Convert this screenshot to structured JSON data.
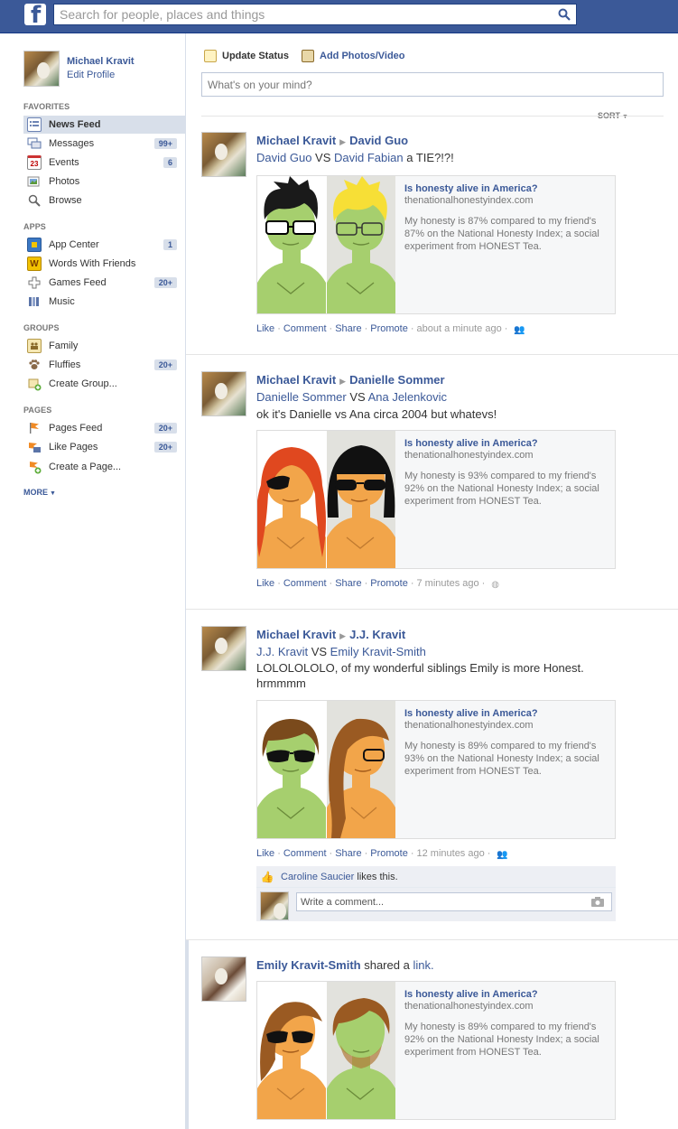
{
  "topbar": {
    "logo": "f",
    "search_placeholder": "Search for people, places and things",
    "search_icon": "magnifier-icon"
  },
  "profile": {
    "name": "Michael Kravit",
    "edit": "Edit Profile"
  },
  "sidebar": {
    "favorites_head": "FAVORITES",
    "favorites": [
      {
        "label": "News Feed",
        "icon": "news-feed-icon",
        "count": ""
      },
      {
        "label": "Messages",
        "icon": "messages-icon",
        "count": "99+"
      },
      {
        "label": "Events",
        "icon": "calendar-icon",
        "count": "6"
      },
      {
        "label": "Photos",
        "icon": "photos-icon",
        "count": ""
      },
      {
        "label": "Browse",
        "icon": "search-icon",
        "count": ""
      }
    ],
    "apps_head": "APPS",
    "apps": [
      {
        "label": "App Center",
        "icon": "app-center-icon",
        "count": "1"
      },
      {
        "label": "Words With Friends",
        "icon": "words-with-friends-icon",
        "count": ""
      },
      {
        "label": "Games Feed",
        "icon": "games-icon",
        "count": "20+"
      },
      {
        "label": "Music",
        "icon": "music-icon",
        "count": ""
      }
    ],
    "groups_head": "GROUPS",
    "groups": [
      {
        "label": "Family",
        "icon": "group-icon",
        "count": ""
      },
      {
        "label": "Fluffies",
        "icon": "paw-icon",
        "count": "20+"
      },
      {
        "label": "Create Group...",
        "icon": "create-group-icon",
        "count": ""
      }
    ],
    "pages_head": "PAGES",
    "pages": [
      {
        "label": "Pages Feed",
        "icon": "flag-icon",
        "count": "20+"
      },
      {
        "label": "Like Pages",
        "icon": "like-pages-icon",
        "count": "20+"
      },
      {
        "label": "Create a Page...",
        "icon": "create-page-icon",
        "count": ""
      }
    ],
    "more": "MORE"
  },
  "composer": {
    "update_status": "Update Status",
    "add_photos": "Add Photos/Video",
    "placeholder": "What's on your mind?",
    "sort": "SORT"
  },
  "share_card": {
    "title": "Is honesty alive in America?",
    "domain": "thenationalhonestyindex.com"
  },
  "stories": [
    {
      "actor": "Michael Kravit",
      "target": "David Guo",
      "vs_a": "David Guo",
      "vs_word": "VS",
      "vs_b": "David Fabian",
      "vs_suffix": "a TIE?!?!",
      "message": "",
      "desc": "My honesty is 87% compared to my friend's 87% on the National Honesty Index; a social experiment from HONEST Tea.",
      "actions": [
        "Like",
        "Comment",
        "Share",
        "Promote"
      ],
      "time": "about a minute ago"
    },
    {
      "actor": "Michael Kravit",
      "target": "Danielle Sommer",
      "vs_a": "Danielle Sommer",
      "vs_word": "VS",
      "vs_b": "Ana Jelenkovic",
      "vs_suffix": "",
      "message": "ok it's Danielle vs Ana circa 2004 but whatevs!",
      "desc": "My honesty is 93% compared to my friend's 92% on the National Honesty Index; a social experiment from HONEST Tea.",
      "actions": [
        "Like",
        "Comment",
        "Share",
        "Promote"
      ],
      "time": "7 minutes ago"
    },
    {
      "actor": "Michael Kravit",
      "target": "J.J. Kravit",
      "vs_a": "J.J. Kravit",
      "vs_word": "VS",
      "vs_b": "Emily Kravit-Smith",
      "vs_suffix": "",
      "message": "LOLOLOLOLO, of my wonderful siblings Emily is more Honest. hrmmmm",
      "desc": "My honesty is 89% compared to my friend's 93% on the National Honesty Index; a social experiment from HONEST Tea.",
      "actions": [
        "Like",
        "Comment",
        "Share",
        "Promote"
      ],
      "time": "12 minutes ago",
      "liker": "Caroline Saucier",
      "likes_text": "likes this.",
      "comment_placeholder": "Write a comment..."
    },
    {
      "actor": "Emily Kravit-Smith",
      "shared_text": "shared a",
      "shared_link": "link.",
      "desc": "My honesty is 89% compared to my friend's 92% on the National Honesty Index; a social experiment from HONEST Tea."
    }
  ],
  "colors": {
    "brand": "#3b5998",
    "face_green": "#a6cf6e",
    "face_orange": "#f2a54a"
  }
}
